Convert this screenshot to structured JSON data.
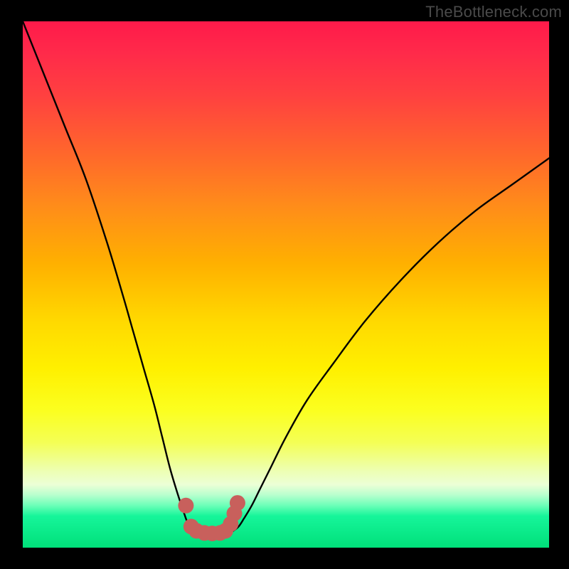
{
  "watermark": "TheBottleneck.com",
  "chart_data": {
    "type": "line",
    "title": "",
    "xlabel": "",
    "ylabel": "",
    "x_range": [
      0,
      100
    ],
    "y_range": [
      0,
      100
    ],
    "series": [
      {
        "name": "left-curve",
        "x": [
          0,
          4,
          8,
          12,
          16,
          19,
          21,
          23,
          25,
          26.5,
          28,
          29.5,
          30.5,
          31.2,
          31.8,
          32.3
        ],
        "y": [
          100,
          90,
          80,
          70,
          58,
          48,
          41,
          34,
          27,
          21,
          15,
          10,
          7,
          5,
          4,
          3.2
        ]
      },
      {
        "name": "right-curve",
        "x": [
          40,
          41,
          42,
          43.5,
          45,
          47,
          50,
          54,
          59,
          65,
          72,
          79,
          86,
          93,
          100
        ],
        "y": [
          3.2,
          4,
          5.5,
          8,
          11,
          15,
          21,
          28,
          35,
          43,
          51,
          58,
          64,
          69,
          74
        ]
      },
      {
        "name": "dot-overlay",
        "style": "dots",
        "points": [
          {
            "x": 31.0,
            "y": 8.0
          },
          {
            "x": 32.0,
            "y": 4.0
          },
          {
            "x": 33.0,
            "y": 3.2
          },
          {
            "x": 34.5,
            "y": 2.8
          },
          {
            "x": 36.0,
            "y": 2.7
          },
          {
            "x": 37.5,
            "y": 2.8
          },
          {
            "x": 38.5,
            "y": 3.2
          },
          {
            "x": 39.5,
            "y": 4.5
          },
          {
            "x": 40.2,
            "y": 6.5
          },
          {
            "x": 40.8,
            "y": 8.5
          }
        ]
      }
    ],
    "background_gradient": {
      "from": "#ff1a4a",
      "to": "#00e07a",
      "direction": "vertical"
    }
  }
}
